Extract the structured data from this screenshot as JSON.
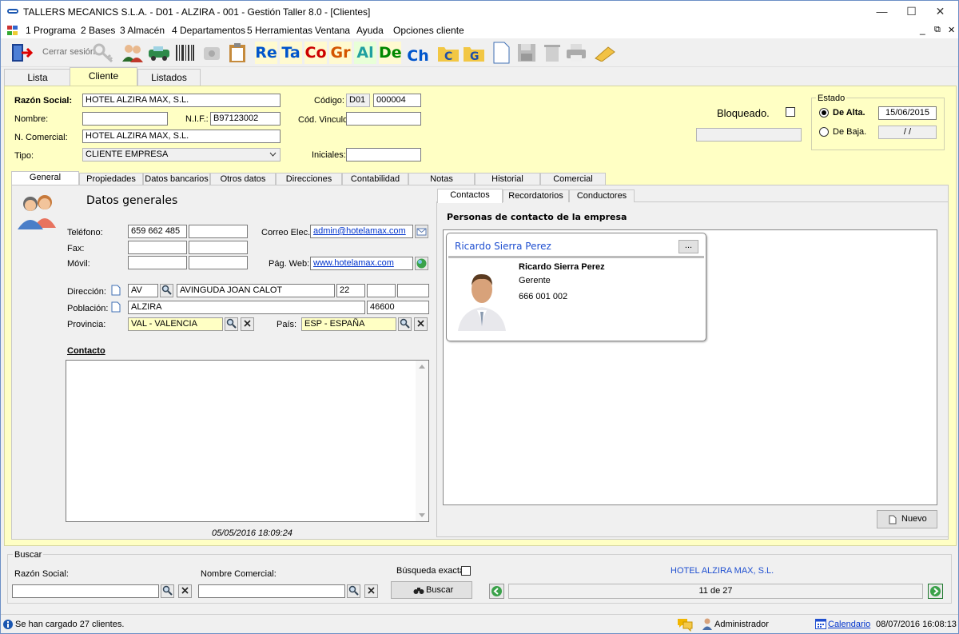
{
  "window": {
    "title": "TALLERS MECANICS S.L.A. - D01 - ALZIRA - 001 - Gestión Taller 8.0 - [Clientes]",
    "min": "—",
    "max": "☐",
    "close": "✕",
    "mdi_min": "_",
    "mdi_restore": "⧉",
    "mdi_close": "✕"
  },
  "menu": [
    "1 Programa",
    "2 Bases",
    "3 Almacén",
    "4 Departamentos",
    "5 Herramientas",
    "Ventana",
    "Ayuda",
    "Opciones cliente"
  ],
  "toolbar": {
    "logout": "Cerrar sesión",
    "letters": [
      "Re",
      "Ta",
      "Co",
      "Gr",
      "Al",
      "De",
      "Ch"
    ],
    "letter_colors": [
      "#0055cc",
      "#0055cc",
      "#cc0000",
      "#d45500",
      "#20a0a0",
      "#008800",
      "#0055cc"
    ]
  },
  "main_tabs": [
    "Lista",
    "Cliente",
    "Listados"
  ],
  "header": {
    "razon_label": "Razón Social:",
    "razon_value": "HOTEL ALZIRA MAX, S.L.",
    "nombre_label": "Nombre:",
    "nombre_value": "",
    "nif_label": "N.I.F.:",
    "nif_value": "B97123002",
    "ncomercial_label": "N. Comercial:",
    "ncomercial_value": "HOTEL ALZIRA MAX, S.L.",
    "tipo_label": "Tipo:",
    "tipo_value": "CLIENTE EMPRESA",
    "codigo_label": "Código:",
    "codigo_prefix": "D01",
    "codigo_value": "000004",
    "vinculo_label": "Cód. Vinculo",
    "iniciales_label": "Iniciales:",
    "bloqueado_label": "Bloqueado.",
    "estado_label": "Estado",
    "alta_label": "De Alta.",
    "alta_date": "15/06/2015",
    "baja_label": "De Baja.",
    "baja_date": " / /"
  },
  "sub_tabs": [
    "General",
    "Propiedades",
    "Datos bancarios",
    "Otros datos",
    "Direcciones",
    "Contabilidad",
    "Notas",
    "Historial",
    "Comercial"
  ],
  "general": {
    "title": "Datos generales",
    "telefono_label": "Teléfono:",
    "telefono": "659 662 485",
    "fax_label": "Fax:",
    "movil_label": "Móvil:",
    "correo_label": "Correo Elec.:",
    "correo": "admin@hotelamax.com",
    "web_label": "Pág. Web:",
    "web": "www.hotelamax.com",
    "direccion_label": "Dirección:",
    "via": "AV",
    "calle": "AVINGUDA JOAN CALOT",
    "numero": "22",
    "poblacion_label": "Población:",
    "poblacion": "ALZIRA",
    "cp": "46600",
    "provincia_label": "Provincia:",
    "provincia": "VAL - VALENCIA",
    "pais_label": "País:",
    "pais": "ESP - ESPAÑA",
    "contacto_label": "Contacto",
    "timestamp": "05/05/2016 18:09:24"
  },
  "right_tabs": [
    "Contactos",
    "Recordatorios",
    "Conductores"
  ],
  "contacts": {
    "heading": "Personas de contacto de la empresa",
    "card_title": "Ricardo Sierra Perez",
    "card_btn": "...",
    "name": "Ricardo Sierra Perez",
    "role": "Gerente",
    "phone": "666 001 002",
    "new_btn": "Nuevo"
  },
  "search": {
    "group_label": "Buscar",
    "razon_label": "Razón Social:",
    "comercial_label": "Nombre Comercial:",
    "exacta_label": "Búsqueda exacta.",
    "buscar_btn": "Buscar",
    "current": "HOTEL ALZIRA MAX, S.L.",
    "position": "11 de 27"
  },
  "status": {
    "message": "Se han cargado 27 clientes.",
    "user": "Administrador",
    "calendar": "Calendario",
    "datetime": "08/07/2016 16:08:13"
  }
}
